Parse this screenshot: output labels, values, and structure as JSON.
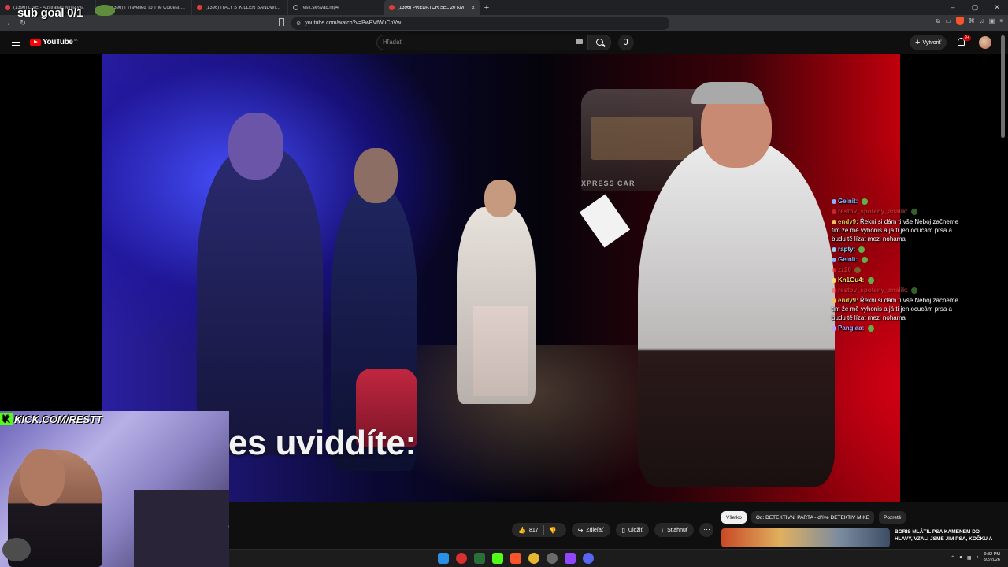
{
  "overlay": {
    "sub_goal": "sub goal 0/1",
    "kick_text": "KICK.COM/RESTT",
    "kick_logo": "K"
  },
  "browser": {
    "tabs": [
      {
        "title": "(1396) LIVE - Australian Ninja Wa",
        "active": false
      },
      {
        "title": "(1396) I Travelled To The Coldest City",
        "active": false
      },
      {
        "title": "(1396) ITALY'S 'KILLER SANDWICH' C",
        "active": false
      },
      {
        "title": "restt.sk/svab.mp4",
        "active": false
      },
      {
        "title": "(1396) PREDÁTOR ŠEL 20 KM",
        "active": true
      }
    ],
    "url": "youtube.com/watch?v=PwBVfWuCnVw",
    "new_tab": "+",
    "close_glyph": "×"
  },
  "youtube": {
    "logo_text": "YouTube",
    "country": "SK",
    "search_placeholder": "Hľadať",
    "create_label": "Vytvoriť",
    "notif_count": "9+"
  },
  "video": {
    "subtitle": "es uviddíte:",
    "van_text": "XPRESS CAR"
  },
  "chat": [
    {
      "user": "Gelnit:",
      "text": "",
      "color": "#8ab4ff",
      "dim": false
    },
    {
      "user": "restov_spoteny_analik:",
      "text": "",
      "color": "#ff4d4d",
      "dim": true
    },
    {
      "user": "endy9:",
      "text": "Řekni si dám ti vše Neboj začneme tim že mě vyhonis a já ti jen ocucám prsa a budu tě lízat mezi nohama",
      "color": "#f0c05a",
      "dim": false
    },
    {
      "user": "rapty:",
      "text": "",
      "color": "#9ad0ff",
      "dim": false
    },
    {
      "user": "Gelnit:",
      "text": "",
      "color": "#8ab4ff",
      "dim": false
    },
    {
      "user": "zz20",
      "text": "",
      "color": "#ff4d4d",
      "dim": true
    },
    {
      "user": "Kn1Gu4:",
      "text": "",
      "color": "#ffdf6b",
      "dim": false
    },
    {
      "user": "restov_spoteny_analik:",
      "text": "",
      "color": "#ff4d4d",
      "dim": true
    },
    {
      "user": "endy9:",
      "text": "Řekni si dám ti vše Neboj začneme tim že mě vyhonis a já ti jen ocucám prsa a budu tě lízat mezi nohama",
      "color": "#f0c05a",
      "dim": false
    },
    {
      "user": "Panglaa:",
      "text": "",
      "color": "#b7a4ff",
      "dim": false
    }
  ],
  "actions": {
    "likes": "817",
    "share": "Zdieľať",
    "save": "Uložiť",
    "download": "Stiahnuť",
    "more": "···"
  },
  "chips": [
    {
      "label": "Všetko",
      "active": true
    },
    {
      "label": "Od: DETEKTIVNÍ PARTA - dříve DETEKTIV MIKE",
      "active": false
    },
    {
      "label": "Pozreté",
      "active": false
    }
  ],
  "recommended": {
    "title": "BORIS MLÁTIL PSA KAMENEM DO HLAVY, VZALI JSME JIM PSA, KOČKU A"
  },
  "taskbar": {
    "time": "9:32 PM",
    "date": "8/2/2026"
  },
  "colors": {
    "yt_red": "#ff0000",
    "kick_green": "#53fc18",
    "accent_bg": "#272727"
  }
}
